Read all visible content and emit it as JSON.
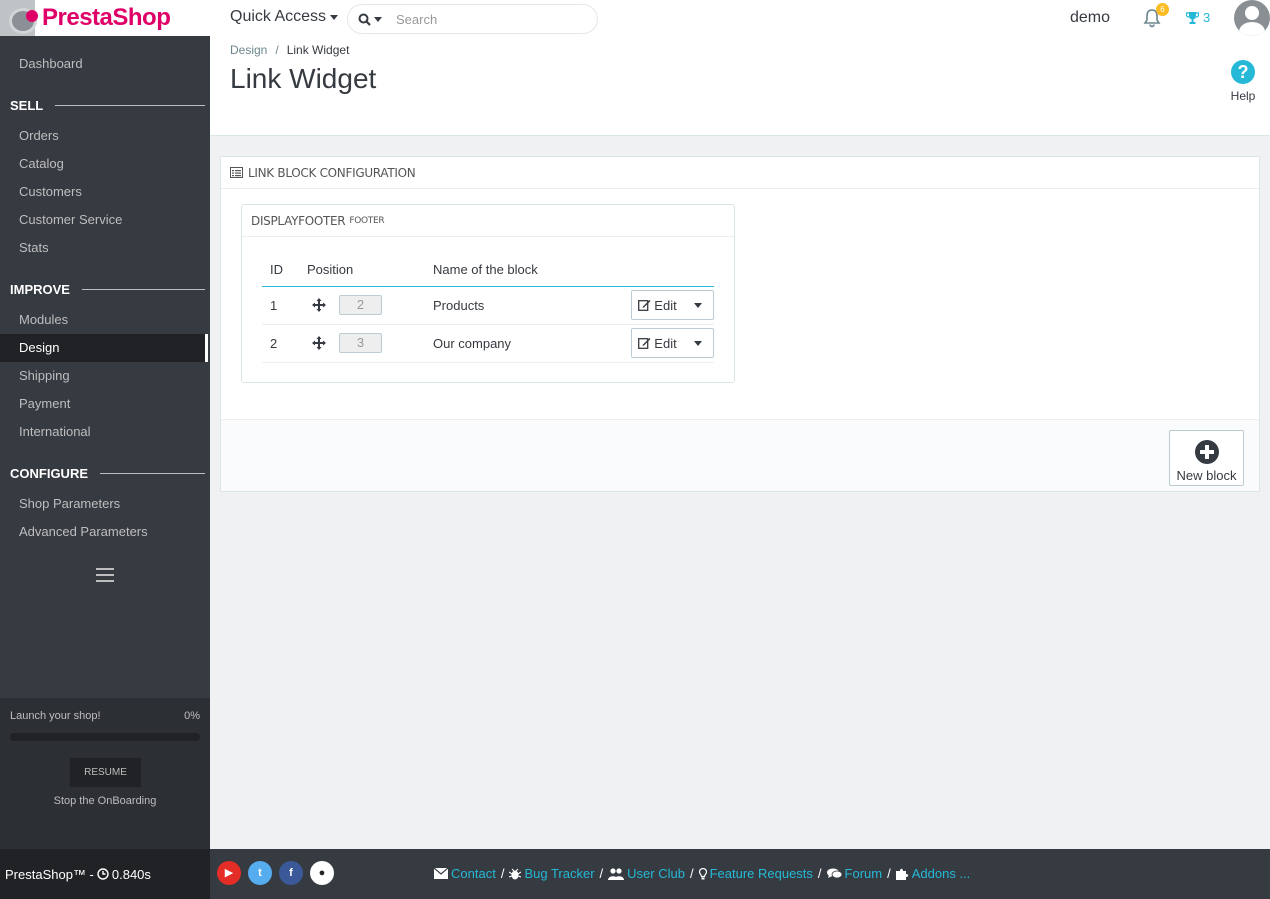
{
  "header": {
    "logo_text": "PrestaShop",
    "quick_access_label": "Quick Access",
    "search_placeholder": "Search",
    "employee_name": "demo",
    "notification_count": "6",
    "trophy_count": "3"
  },
  "sidebar": {
    "items": [
      {
        "type": "item",
        "label": "Dashboard",
        "active": false
      },
      {
        "type": "section",
        "label": "SELL"
      },
      {
        "type": "item",
        "label": "Orders",
        "active": false
      },
      {
        "type": "item",
        "label": "Catalog",
        "active": false
      },
      {
        "type": "item",
        "label": "Customers",
        "active": false
      },
      {
        "type": "item",
        "label": "Customer Service",
        "active": false
      },
      {
        "type": "item",
        "label": "Stats",
        "active": false
      },
      {
        "type": "section",
        "label": "IMPROVE"
      },
      {
        "type": "item",
        "label": "Modules",
        "active": false
      },
      {
        "type": "item",
        "label": "Design",
        "active": true
      },
      {
        "type": "item",
        "label": "Shipping",
        "active": false
      },
      {
        "type": "item",
        "label": "Payment",
        "active": false
      },
      {
        "type": "item",
        "label": "International",
        "active": false
      },
      {
        "type": "section",
        "label": "CONFIGURE"
      },
      {
        "type": "item",
        "label": "Shop Parameters",
        "active": false
      },
      {
        "type": "item",
        "label": "Advanced Parameters",
        "active": false
      }
    ],
    "onboarding": {
      "title": "Launch your shop!",
      "progress_label": "0%",
      "progress_fraction": 0,
      "resume_label": "RESUME",
      "stop_label": "Stop the OnBoarding"
    }
  },
  "page_head": {
    "breadcrumb_parent": "Design",
    "breadcrumb_separator": "/",
    "breadcrumb_current": "Link Widget",
    "title": "Link Widget",
    "help_label": "Help"
  },
  "panel": {
    "heading": "LINK BLOCK CONFIGURATION",
    "hook_name": "DISPLAYFOOTER",
    "hook_sub": "FOOTER",
    "columns": [
      "ID",
      "Position",
      "Name of the block"
    ],
    "rows": [
      {
        "id": "1",
        "position": "2",
        "name": "Products",
        "action": "Edit"
      },
      {
        "id": "2",
        "position": "3",
        "name": "Our company",
        "action": "Edit"
      }
    ],
    "new_block_label": "New block"
  },
  "footer": {
    "version_text": "PrestaShop™ -",
    "load_time": "0.840s",
    "links": [
      {
        "label": "Contact",
        "icon": "envelope-icon"
      },
      {
        "label": "Bug Tracker",
        "icon": "bug-icon"
      },
      {
        "label": "User Club",
        "icon": "users-icon"
      },
      {
        "label": "Feature Requests",
        "icon": "lightbulb-icon"
      },
      {
        "label": "Forum",
        "icon": "comments-icon"
      },
      {
        "label": "Addons ...",
        "icon": "puzzle-icon"
      }
    ],
    "link_separator": "/"
  },
  "colors": {
    "brand": "#df0067",
    "accent": "#25b9d7",
    "sidebar_bg": "#363a41",
    "notification_badge": "#fbbb22"
  }
}
